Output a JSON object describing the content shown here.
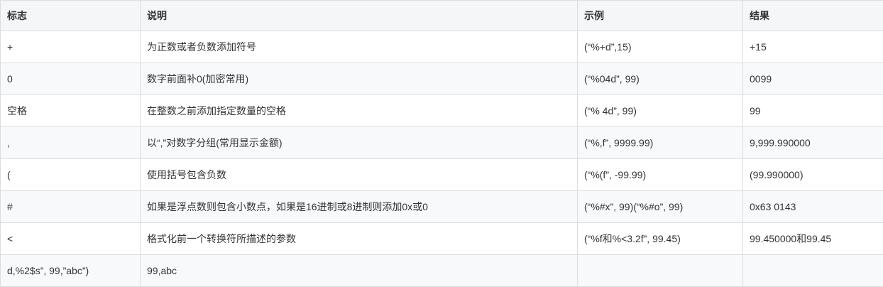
{
  "table": {
    "headers": [
      "标志",
      "说明",
      "示例",
      "结果"
    ],
    "rows": [
      [
        "+",
        "为正数或者负数添加符号",
        "(“%+d”,15)",
        "+15"
      ],
      [
        "0",
        "数字前面补0(加密常用)",
        "(“%04d”, 99)",
        "0099"
      ],
      [
        "空格",
        "在整数之前添加指定数量的空格",
        "(“% 4d”, 99)",
        "99"
      ],
      [
        ",",
        "以“,”对数字分组(常用显示金额)",
        "(“%,f”, 9999.99)",
        "9,999.990000"
      ],
      [
        "(",
        "使用括号包含负数",
        "(“%(f”, -99.99)",
        "(99.990000)"
      ],
      [
        "#",
        "如果是浮点数则包含小数点，如果是16进制或8进制则添加0x或0",
        "(“%#x”, 99)(“%#o”, 99)",
        "0x63 0143"
      ],
      [
        "<",
        "格式化前一个转换符所描述的参数",
        "(“%f和%<3.2f”, 99.45)",
        "99.450000和99.45"
      ],
      [
        "d,%2$s”, 99,”abc”)",
        "99,abc",
        "",
        ""
      ]
    ]
  }
}
